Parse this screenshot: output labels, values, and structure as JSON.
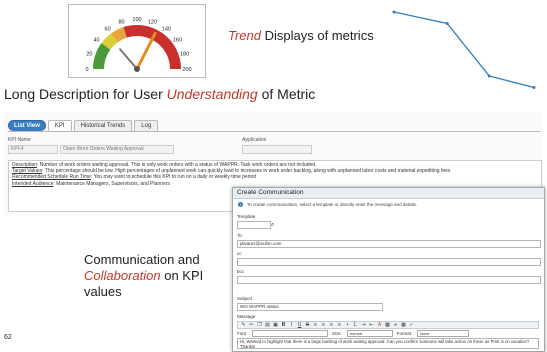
{
  "gauge": {
    "ticks": [
      "0",
      "20",
      "40",
      "60",
      "80",
      "100",
      "120",
      "140",
      "160",
      "180",
      "200"
    ],
    "value": 130,
    "colors": {
      "red": "#c9302c",
      "orange": "#e8a33a",
      "yellow": "#d9cf34",
      "green": "#4a9a3b",
      "needle_main": "#e88a1a",
      "needle_alt": "#777777"
    }
  },
  "trend": {
    "label_em": "Trend",
    "label_rest": " Displays of metrics",
    "chart_data": {
      "type": "line",
      "values": [
        100,
        86,
        22,
        8
      ]
    }
  },
  "long_desc": {
    "prefix": "Long Description for User ",
    "em": "Understanding",
    "suffix": " of Metric"
  },
  "tabs": [
    {
      "label": "List View"
    },
    {
      "label": "KPI"
    },
    {
      "label": "Historical Trends"
    },
    {
      "label": "Log"
    }
  ],
  "kpi": {
    "name_label": "KPI Name",
    "name_value": "KPI-4",
    "title_value": "Open Work Orders Waiting Approval",
    "application_label": "Application"
  },
  "description": {
    "d_label": "Description",
    "d_text": ": Number of work orders waiting approval. This is only work orders with a status of WAPPR. Task work orders are not included.",
    "t_label": "Target Values",
    "t_text": ": This percentage should be low. High percentages of unplanned work can quickly lead to increases in work order backlog, along with unplanned labor costs and material expediting fees",
    "r_label": "Recommended Schedule Run Time",
    "r_text": ": You may want to schedule this KPI to run on a daily or weekly time period",
    "a_label": "Intended Audience",
    "a_text": ": Maintenance Managers, Supervisors, and Planners"
  },
  "comm_text": {
    "line1": "Communication and",
    "em": "Collaboration",
    "line2_rest": " on KPI",
    "line3": "values"
  },
  "page_number": "62",
  "dialog": {
    "title": "Create Communication",
    "info": "To create communication, select a template or directly enter the message and details.",
    "template_label": "Template",
    "to_label": "To",
    "to_value": "jalvarez@acilim.com",
    "cc_label": "cc",
    "bcc_label": "bcc",
    "subject_label": "Subject",
    "subject_value": "WO WAPPR status",
    "message_label": "Message",
    "font_label": "Font",
    "size_label": "Size",
    "size_value": "normal",
    "format_label": "Format",
    "format_value": "None",
    "message_text": "Hi,  Wanted to highlight that there is a large backlog of work waiting approval.  Can you confirm someone will take action on these as Print is on vacation?  Thanks!"
  }
}
